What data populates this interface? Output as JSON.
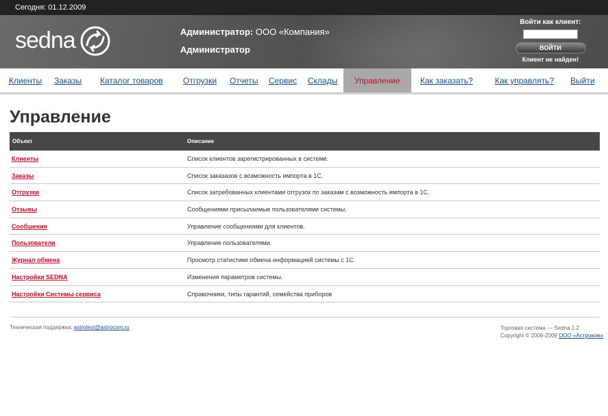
{
  "topbar": {
    "today": "Сегодня: 01.12.2009"
  },
  "header": {
    "logo": "sedna",
    "admin_prefix": "Администратор:",
    "admin_company": "ООО «Компания»",
    "admin_role": "Администратор"
  },
  "login": {
    "label": "Войти как клиент:",
    "input_value": "",
    "button": "ВОЙТИ",
    "status": "Клиент не найден!"
  },
  "nav": [
    {
      "label": "Клиенты",
      "active": false
    },
    {
      "label": "Заказы",
      "active": false
    },
    {
      "label": "Каталог товаров",
      "active": false
    },
    {
      "label": "Отгрузки",
      "active": false
    },
    {
      "label": "Отчеты",
      "active": false
    },
    {
      "label": "Сервис",
      "active": false
    },
    {
      "label": "Склады",
      "active": false
    },
    {
      "label": "Управление",
      "active": true
    },
    {
      "label": "Как заказать?",
      "active": false
    },
    {
      "label": "Как управлять?",
      "active": false
    },
    {
      "label": "Выйти",
      "active": false
    }
  ],
  "page": {
    "title": "Управление"
  },
  "table": {
    "headers": [
      "Объект",
      "Описание"
    ],
    "rows": [
      {
        "object": "Клиенты",
        "description": "Список клиентов зарегистрированных в системе."
      },
      {
        "object": "Заказы",
        "description": "Список заказазов с возможность импорта в 1С."
      },
      {
        "object": "Отгрузки",
        "description": "Список затребованных клиентами отгрузок по заказам с возможность импорта в 1С."
      },
      {
        "object": "Отзывы",
        "description": "Сообщениями присылаемые пользователями системы."
      },
      {
        "object": "Сообщения",
        "description": "Управление сообщениями для клиентов."
      },
      {
        "object": "Пользователи",
        "description": "Управление пользователями."
      },
      {
        "object": "Журнал обмена",
        "description": "Просмотр статистики обмена информацией системы с 1С."
      },
      {
        "object": "Настройки SEDNA",
        "description": "Изменения параметров системы."
      },
      {
        "object": "Настройки Системы сервиса",
        "description": "Справочники, типы гарантий, семейства приборов"
      }
    ]
  },
  "footer": {
    "support_label": "Техническая поддержка:",
    "support_email": "astrotest@astrocom.ru",
    "system": "Торговая система — Sedna 1.2",
    "copyright": "Copyright © 2006-2009",
    "company_link": "ООО «Астроком»"
  },
  "colors": {
    "accent": "#c8102e",
    "link": "#1a4e8a",
    "header_dark": "#474747"
  }
}
